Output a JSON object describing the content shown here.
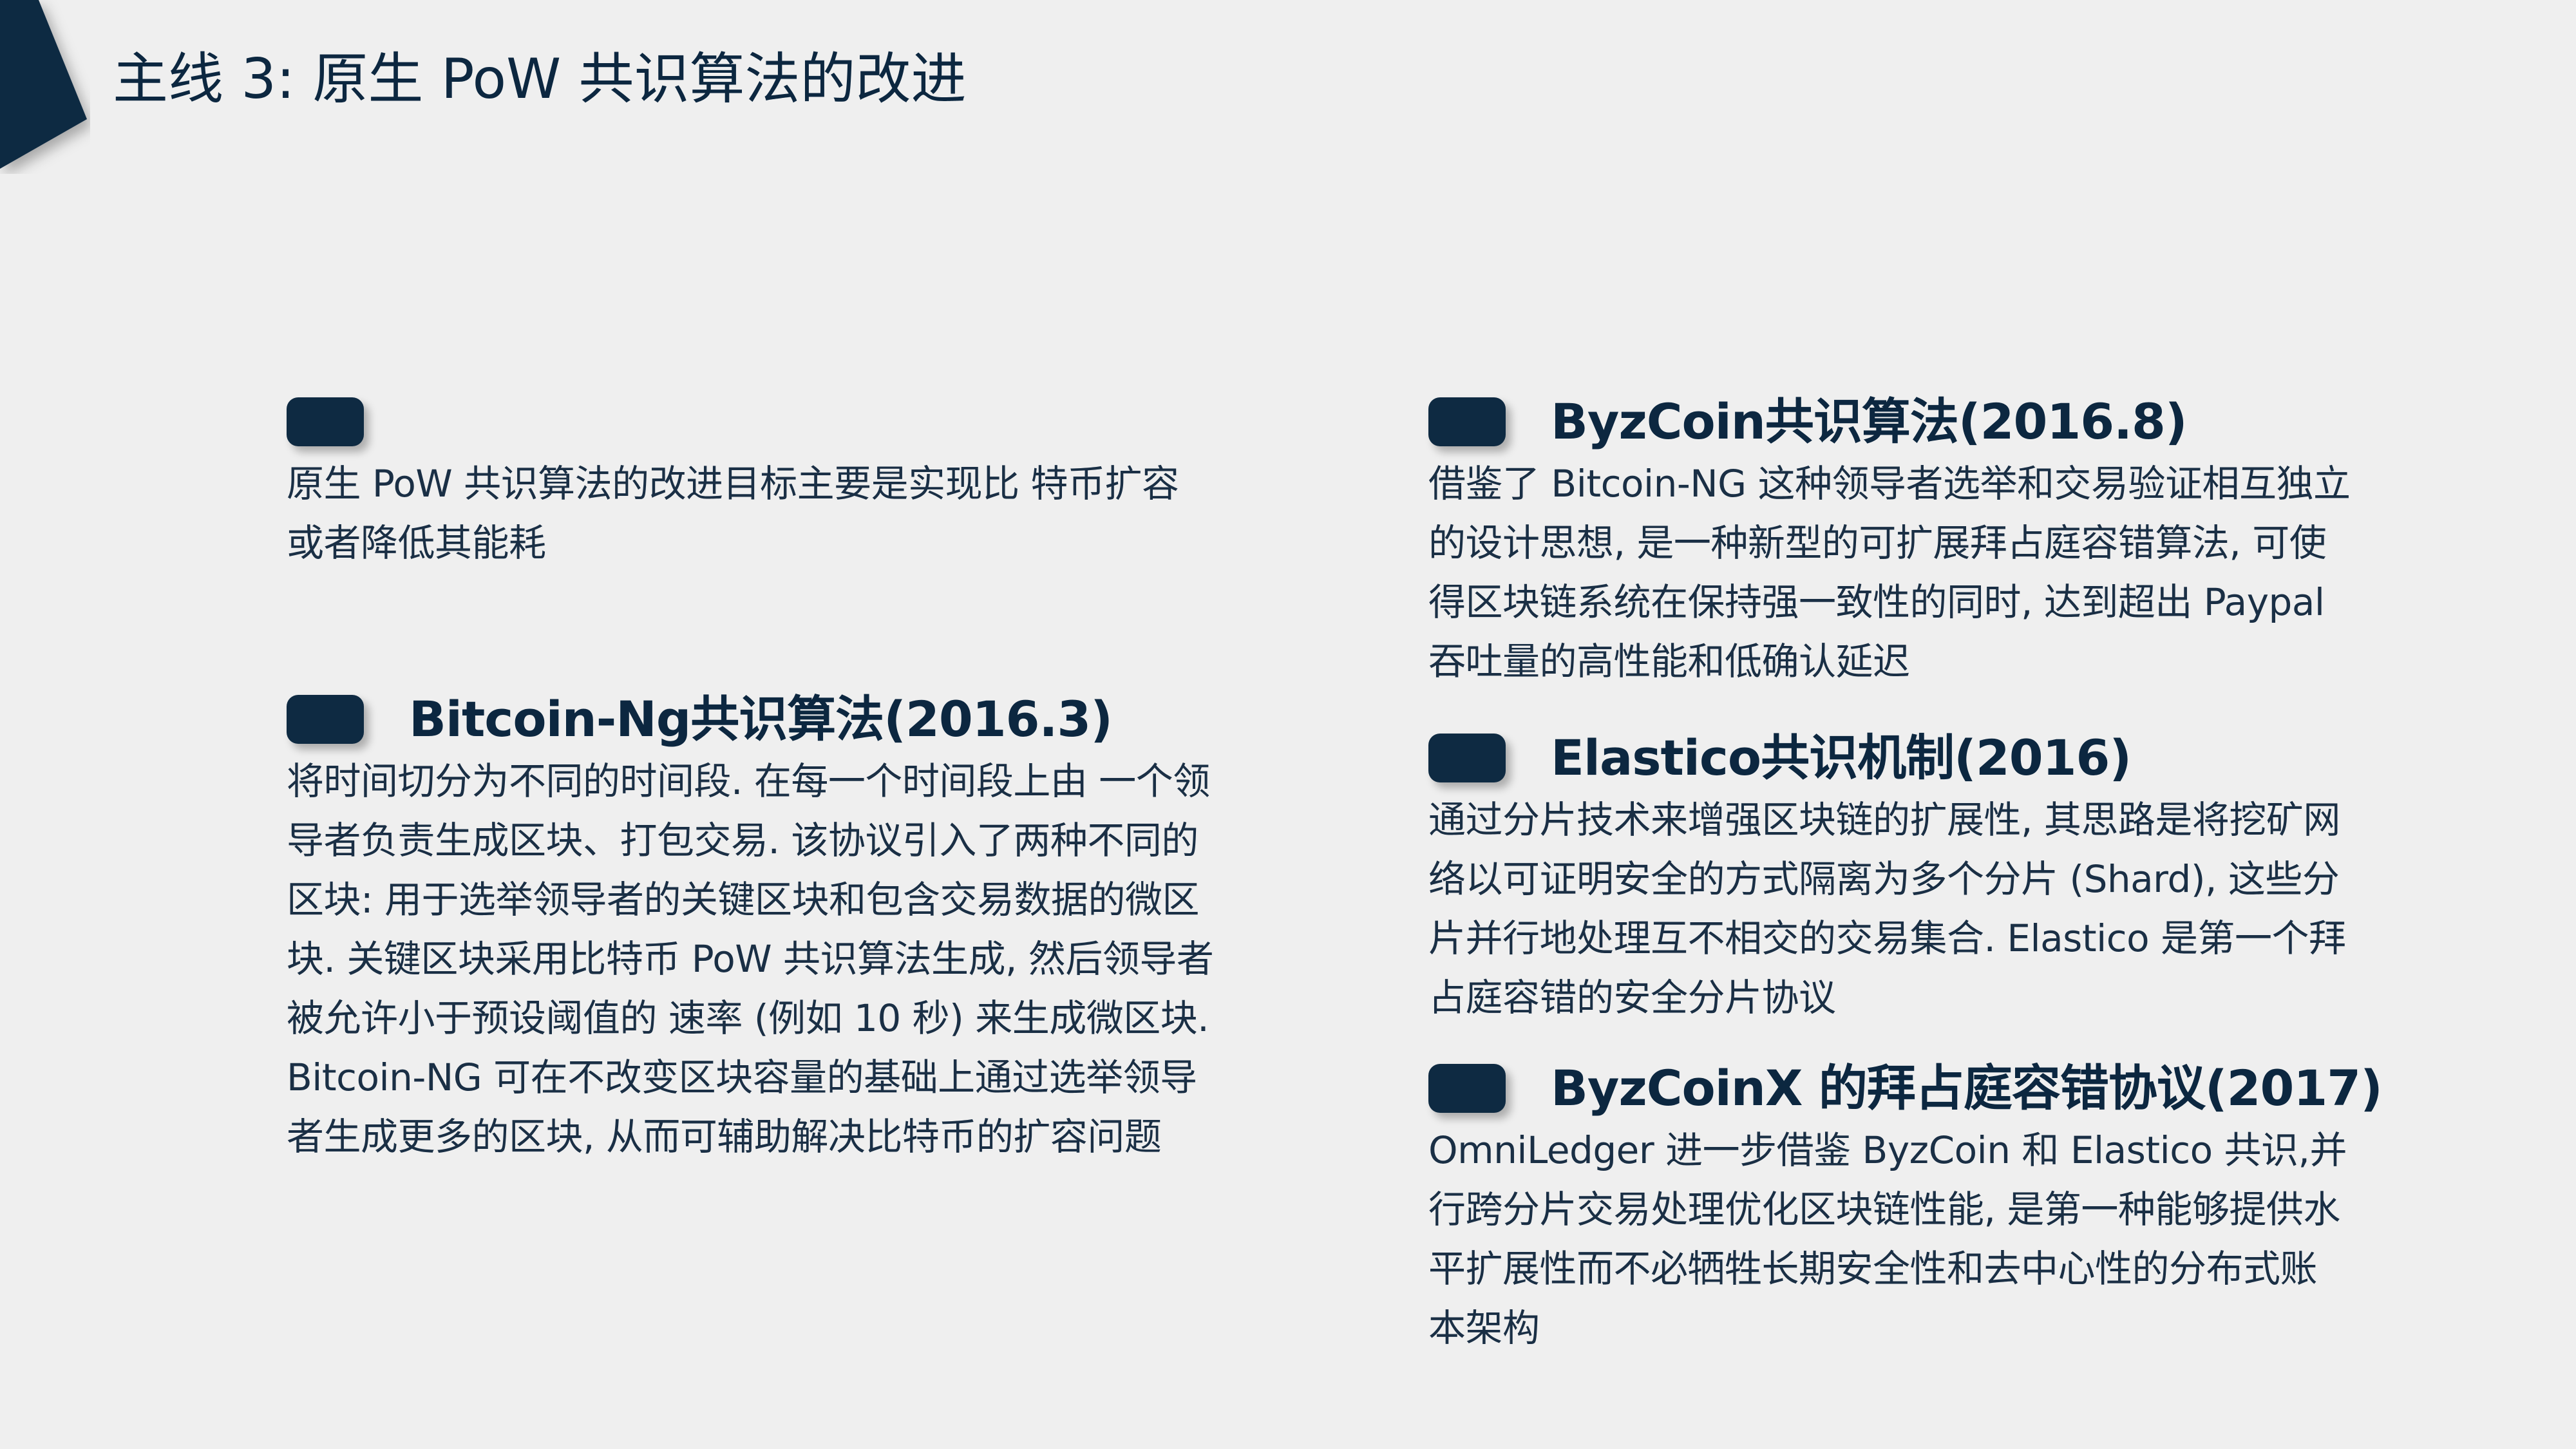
{
  "title": "主线 3: 原生 PoW 共识算法的改进",
  "blocks": [
    {
      "heading": "",
      "lines": [
        "原生 PoW 共识算法的改进目标主要是实现比 特币扩容",
        "或者降低其能耗"
      ]
    },
    {
      "heading": "Bitcoin-Ng共识算法(2016.3)",
      "lines": [
        "将时间切分为不同的时间段. 在每一个时间段上由 一个领",
        "导者负责生成区块、打包交易. 该协议引入了两种不同的",
        "区块: 用于选举领导者的关键区块和包含交易数据的微区",
        "块. 关键区块采用比特币 PoW 共识算法生成, 然后领导者",
        "被允许小于预设阈值的 速率 (例如 10 秒) 来生成微区块.",
        "Bitcoin-NG 可在不改变区块容量的基础上通过选举领导",
        "者生成更多的区块, 从而可辅助解决比特币的扩容问题"
      ]
    },
    {
      "heading": "ByzCoin共识算法(2016.8)",
      "lines": [
        "借鉴了 Bitcoin-NG 这种领导者选举和交易验证相互独立",
        "的设计思想, 是一种新型的可扩展拜占庭容错算法, 可使",
        "得区块链系统在保持强一致性的同时, 达到超出 Paypal",
        "吞吐量的高性能和低确认延迟"
      ]
    },
    {
      "heading": "Elastico共识机制(2016)",
      "lines": [
        "通过分片技术来增强区块链的扩展性, 其思路是将挖矿网",
        "络以可证明安全的方式隔离为多个分片 (Shard), 这些分",
        "片并行地处理互不相交的交易集合. Elastico 是第一个拜",
        "占庭容错的安全分片协议"
      ]
    },
    {
      "heading": "ByzCoinX 的拜占庭容错协议(2017)",
      "lines": [
        "OmniLedger 进一步借鉴 ByzCoin 和 Elastico 共识,并",
        "行跨分片交易处理优化区块链性能, 是第一种能够提供水",
        "平扩展性而不必牺牲长期安全性和去中心性的分布式账",
        "本架构"
      ]
    }
  ],
  "colors": {
    "background": "#efefef",
    "accent": "#0e2a42",
    "text": "#1a2f45"
  }
}
